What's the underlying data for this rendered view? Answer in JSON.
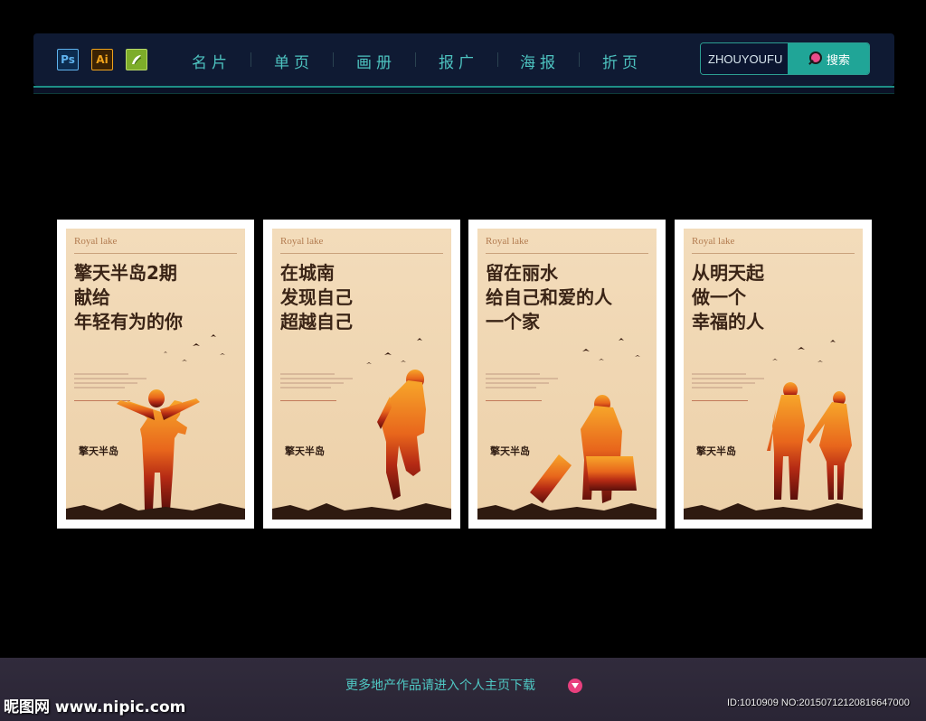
{
  "toolbar": {
    "software_icons": [
      {
        "name": "ps-icon",
        "label": "Ps",
        "color": "#5fb3ee"
      },
      {
        "name": "ai-icon",
        "label": "Ai",
        "color": "#f0a31c"
      },
      {
        "name": "cdr-icon",
        "label": "",
        "color": "#7dad29"
      }
    ],
    "nav_items": [
      "名片",
      "单页",
      "画册",
      "报广",
      "海报",
      "折页"
    ],
    "search": {
      "value": "ZHOUYOUFU",
      "button_label": "搜索"
    }
  },
  "posters": [
    {
      "brand_en": "Royal lake",
      "headline": [
        "擎天半岛2期",
        "献给",
        "年轻有为的你"
      ],
      "logo_cn": "擎天半岛"
    },
    {
      "brand_en": "Royal lake",
      "headline": [
        "在城南",
        "发现自己",
        "超越自己"
      ],
      "logo_cn": "擎天半岛"
    },
    {
      "brand_en": "Royal lake",
      "headline": [
        "留在丽水",
        "给自己和爱的人",
        "一个家"
      ],
      "logo_cn": "擎天半岛"
    },
    {
      "brand_en": "Royal lake",
      "headline": [
        "从明天起",
        "做一个",
        "幸福的人"
      ],
      "logo_cn": "擎天半岛"
    }
  ],
  "footer": {
    "text": "更多地产作品请进入个人主页下载",
    "watermark_site": "昵图网 www.nipic.com",
    "watermark_id": "ID:1010909 NO:20150712120816647000"
  },
  "colors": {
    "nav_bg": "#0f1a33",
    "accent": "#20a597",
    "nav_text": "#4dc3c0",
    "poster_bg": "#efd5b0",
    "headline": "#3a2416",
    "footer_text": "#4fc7c3",
    "footer_icon": "#e8407e"
  }
}
